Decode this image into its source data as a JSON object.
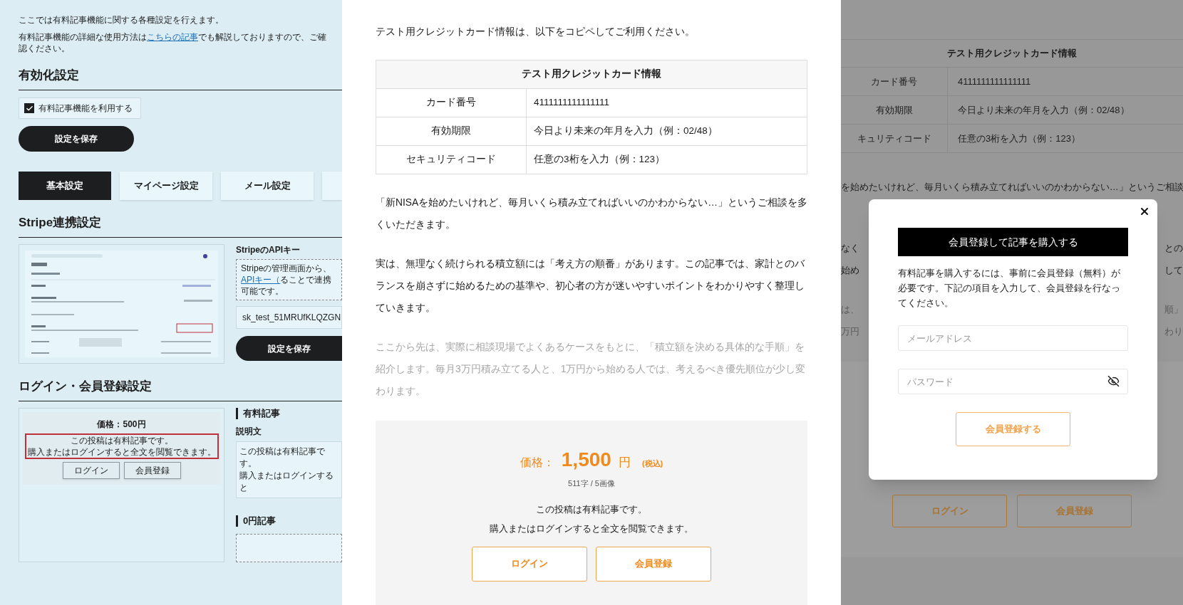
{
  "settings": {
    "intro": "ここでは有料記事機能に関する各種設定を行えます。",
    "guide": {
      "before": "有料記事機能の詳細な使用方法は",
      "link": "こちらの記事",
      "after": "でも解説しておりますので、ご確認ください。"
    },
    "activation": {
      "heading": "有効化設定",
      "checkbox": {
        "label": "有料記事機能を利用する",
        "checked": true
      },
      "save_button": "設定を保存"
    },
    "tabs": [
      {
        "label": "基本設定",
        "selected": true
      },
      {
        "label": "マイページ設定",
        "selected": false
      },
      {
        "label": "メール設定",
        "selected": false
      }
    ],
    "stripe": {
      "heading": "Stripe連携設定",
      "api_key_title": "StripeのAPIキー",
      "help": {
        "before": "Stripeの管理画面から、",
        "link": "APIキー（",
        "after": "ることで連携可能です。"
      },
      "api_key_value": "sk_test_51MRUfKLQZGN",
      "save_button": "設定を保存"
    },
    "login": {
      "heading": "ログイン・会員登録設定",
      "preview": {
        "price": "価格：500円",
        "notice": [
          "この投稿は有料記事です。",
          "購入またはログインすると全文を閲覧できます。"
        ],
        "buttons": [
          "ログイン",
          "会員登録"
        ]
      },
      "paid_article": {
        "heading": "有料記事",
        "description_label": "説明文",
        "description": [
          "この投稿は有料記事です。",
          "購入またはログインすると"
        ]
      },
      "free_article": {
        "heading": "0円記事"
      }
    }
  },
  "article": {
    "intro": "テスト用クレジットカード情報は、以下をコピペしてご利用ください。",
    "card_table": {
      "title": "テスト用クレジットカード情報",
      "rows": [
        {
          "label": "カード番号",
          "value": "4111111111111111"
        },
        {
          "label": "有効期限",
          "value": "今日より未来の年月を入力（例：02/48）"
        },
        {
          "label": "セキュリティコード",
          "value": "任意の3桁を入力（例：123）"
        }
      ]
    },
    "paragraphs": [
      {
        "text": "「新NISAを始めたいけれど、毎月いくら積み立てればいいのかわからない…」というご相談を多くいただきます。",
        "faded": false
      },
      {
        "text": "実は、無理なく続けられる積立額には「考え方の順番」があります。この記事では、家計とのバランスを崩さずに始めるための基準や、初心者の方が迷いやすいポイントをわかりやすく整理していきます。",
        "faded": false
      },
      {
        "text": "ここから先は、実際に相談現場でよくあるケースをもとに、「積立額を決める具体的な手順」を紹介します。毎月3万円積み立てる人と、1万円から始める人では、考えるべき優先順位が少し変わります。",
        "faded": true
      }
    ],
    "paywall": {
      "price_label": "価格：",
      "price": "1,500",
      "unit": "円",
      "tax_note": "(税込)",
      "stats": "511字 / 5画像",
      "notice": [
        "この投稿は有料記事です。",
        "購入またはログインすると全文を閲覧できます。"
      ],
      "buttons": [
        "ログイン",
        "会員登録"
      ]
    }
  },
  "modal_screen": {
    "background": {
      "table_title": "テスト用クレジットカード情報",
      "rows": [
        {
          "label": "カード番号",
          "value": "4111111111111111"
        },
        {
          "label": "有効期限",
          "value": "今日より未来の年月を入力（例：02/48）"
        },
        {
          "label": "キュリティコード",
          "value": "任意の3桁を入力（例：123）"
        }
      ],
      "paragraph_line": "を始めたいけれど、毎月いくら積み立てればいいのかわからない…」というご相談",
      "fragments": [
        {
          "left": "なく",
          "right": "との"
        },
        {
          "left": "始め",
          "right": "して"
        },
        {
          "left": "は、",
          "right": "順」"
        },
        {
          "left": "万円",
          "right": "わり"
        }
      ],
      "buttons": [
        "ログイン",
        "会員登録"
      ]
    },
    "dialog": {
      "title": "会員登録して記事を購入する",
      "description": "有料記事を購入するには、事前に会員登録（無料）が必要です。下記の項目を入力して、会員登録を行なってください。",
      "email_placeholder": "メールアドレス",
      "password_placeholder": "パスワード",
      "submit": "会員登録する"
    }
  }
}
